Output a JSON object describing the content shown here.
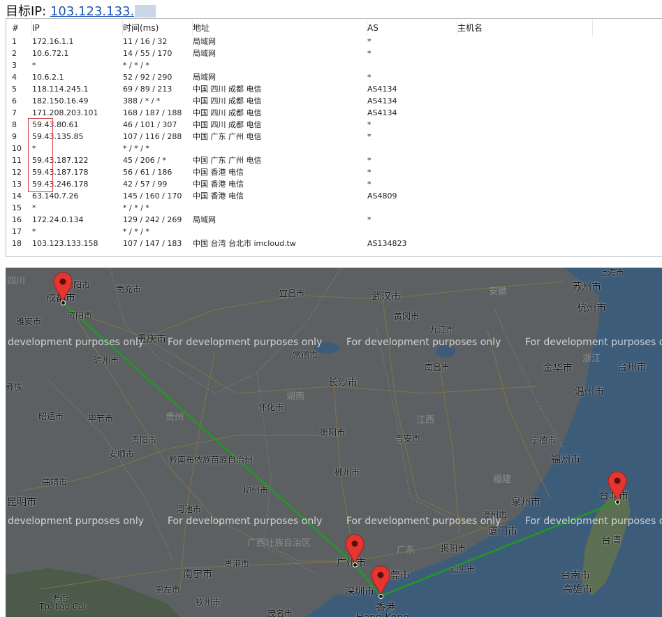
{
  "header": {
    "label": "目标IP:",
    "ip": "103.123.133."
  },
  "table": {
    "columns": [
      "#",
      "IP",
      "时间(ms)",
      "地址",
      "AS",
      "主机名"
    ],
    "rows": [
      {
        "n": "1",
        "ip": "172.16.1.1",
        "time": "11 / 16 / 32",
        "addr": "局域网",
        "as": "*"
      },
      {
        "n": "2",
        "ip": "10.6.72.1",
        "time": "14 / 55 / 170",
        "addr": "局域网",
        "as": "*"
      },
      {
        "n": "3",
        "ip": "*",
        "time": "* / * / *",
        "addr": "",
        "as": ""
      },
      {
        "n": "4",
        "ip": "10.6.2.1",
        "time": "52 / 92 / 290",
        "addr": "局域网",
        "as": "*"
      },
      {
        "n": "5",
        "ip": "118.114.245.1",
        "time": "69 / 89 / 213",
        "addr": "中国 四川 成都 电信",
        "as": "AS4134"
      },
      {
        "n": "6",
        "ip": "182.150.16.49",
        "time": "388 / * / *",
        "addr": "中国 四川 成都 电信",
        "as": "AS4134"
      },
      {
        "n": "7",
        "ip": "171.208.203.101",
        "time": "168 / 187 / 188",
        "addr": "中国 四川 成都 电信",
        "as": "AS4134"
      },
      {
        "n": "8",
        "ip": "59.43.80.61",
        "time": "46 / 101 / 307",
        "addr": "中国 四川 成都 电信",
        "as": "*"
      },
      {
        "n": "9",
        "ip": "59.43.135.85",
        "time": "107 / 116 / 288",
        "addr": "中国 广东 广州 电信",
        "as": "*"
      },
      {
        "n": "10",
        "ip": "*",
        "time": "* / * / *",
        "addr": "",
        "as": ""
      },
      {
        "n": "11",
        "ip": "59.43.187.122",
        "time": "45 / 206 / *",
        "addr": "中国 广东 广州 电信",
        "as": "*"
      },
      {
        "n": "12",
        "ip": "59.43.187.178",
        "time": "56 / 61 / 186",
        "addr": "中国 香港 电信",
        "as": "*"
      },
      {
        "n": "13",
        "ip": "59.43.246.178",
        "time": "42 / 57 / 99",
        "addr": "中国 香港 电信",
        "as": "*"
      },
      {
        "n": "14",
        "ip": "63.140.7.26",
        "time": "145 / 160 / 170",
        "addr": "中国 香港 电信",
        "as": "AS4809"
      },
      {
        "n": "15",
        "ip": "*",
        "time": "* / * / *",
        "addr": "",
        "as": ""
      },
      {
        "n": "16",
        "ip": "172.24.0.134",
        "time": "129 / 242 / 269",
        "addr": "局域网",
        "as": "*"
      },
      {
        "n": "17",
        "ip": "*",
        "time": "* / * / *",
        "addr": "",
        "as": ""
      },
      {
        "n": "18",
        "ip": "103.123.133.158",
        "time": "107 / 147 / 183",
        "addr": "中国 台湾 台北市 imcloud.tw",
        "as": "AS134823"
      }
    ]
  },
  "map": {
    "watermark": "For development purposes only",
    "route_color": "#1f9a1f",
    "marker_color": "#e5352e",
    "labels": [
      "四川",
      "德阳市",
      "南充市",
      "成都市",
      "资阳市",
      "雅安市",
      "重庆市",
      "泸州市",
      "宜昌市",
      "武汉市",
      "黄冈市",
      "安徽",
      "上海市",
      "苏州市",
      "杭州市",
      "九江市",
      "常德市",
      "长沙市",
      "湖南",
      "南昌市",
      "江西",
      "金华市",
      "浙江",
      "台州市",
      "温州市",
      "彝族",
      "昭通市",
      "毕节市",
      "贵州",
      "怀化市",
      "贵阳市",
      "衡阳市",
      "吉安市",
      "安顺市",
      "黔南布依族苗族自治州",
      "宁德市",
      "曲靖市",
      "福州市",
      "郴州市",
      "福建",
      "柳州市",
      "昆明市",
      "泉州市",
      "河池市",
      "厦门市",
      "漳州市",
      "广西壮族自治区",
      "广东",
      "揭阳市",
      "汕头市",
      "台北市",
      "台湾",
      "贵港市",
      "广州市",
      "东莞市",
      "南宁市",
      "崇左市",
      "钦州市",
      "深圳市",
      "香港",
      "台南市",
      "高雄市",
      "老街",
      "Tp. Lào Cai",
      "Hong Kong",
      "茂名市"
    ]
  }
}
